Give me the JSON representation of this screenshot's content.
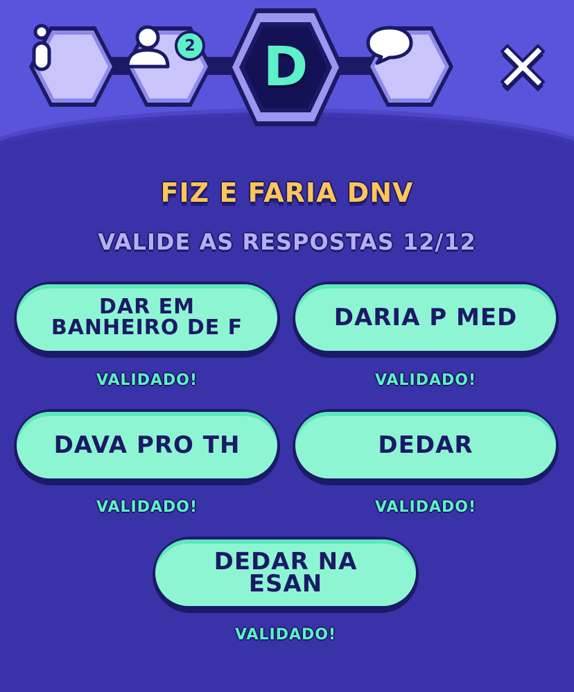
{
  "header": {
    "players_badge_count": "2",
    "current_letter": "D",
    "icons": {
      "info": "info-icon",
      "players": "user-icon",
      "chat": "chat-bubble-icon",
      "close": "close-icon"
    }
  },
  "round": {
    "category_title": "FIZ E FARIA DNV",
    "validation_progress": "VALIDE AS RESPOSTAS 12/12"
  },
  "answers": [
    {
      "text": "DAR EM BANHEIRO DE F",
      "status": "VALIDADO!"
    },
    {
      "text": "DARIA P MED",
      "status": "VALIDADO!"
    },
    {
      "text": "DAVA PRO TH",
      "status": "VALIDADO!"
    },
    {
      "text": "DEDAR",
      "status": "VALIDADO!"
    },
    {
      "text": "DEDAR NA ESAN",
      "status": "VALIDADO!"
    }
  ],
  "colors": {
    "background": "#3a32a8",
    "header": "#5a54dc",
    "answer_fill": "#8ef5d3",
    "title": "#ffc55a",
    "validated": "#5ef0c8"
  }
}
